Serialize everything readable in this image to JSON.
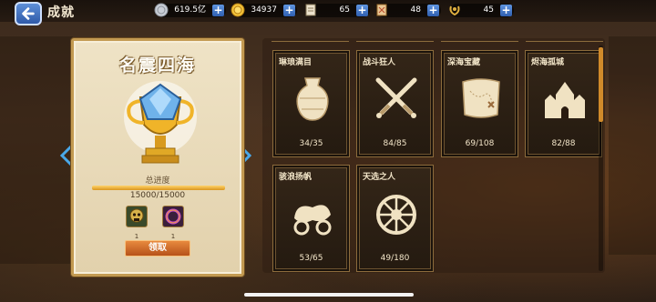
{
  "header": {
    "title": "成就",
    "back_icon": "back-arrow-icon"
  },
  "resources": [
    {
      "name": "silver",
      "icon": "silver-coin-icon",
      "value": "619.5亿"
    },
    {
      "name": "gold",
      "icon": "gold-coin-icon",
      "value": "34937"
    },
    {
      "name": "scroll",
      "icon": "scroll-icon",
      "value": "65"
    },
    {
      "name": "map",
      "icon": "map-icon",
      "value": "48"
    },
    {
      "name": "laurel",
      "icon": "laurel-icon",
      "value": "45"
    }
  ],
  "detail": {
    "title": "名震四海",
    "progress_label": "总进度",
    "progress_text": "15000/15000",
    "progress_fraction": 1.0,
    "rewards": [
      {
        "icon": "skull-badge-icon",
        "count": "1"
      },
      {
        "icon": "purple-ring-icon",
        "count": "1"
      }
    ],
    "claim_label": "领取"
  },
  "achievements": [
    {
      "title": "琳琅满目",
      "icon": "vase-icon",
      "count": "34/35"
    },
    {
      "title": "战斗狂人",
      "icon": "crossed-swords-icon",
      "count": "84/85"
    },
    {
      "title": "深海宝藏",
      "icon": "treasure-map-icon",
      "count": "69/108"
    },
    {
      "title": "烬海孤城",
      "icon": "castle-icon",
      "count": "82/88"
    },
    {
      "title": "骇浪扬帆",
      "icon": "cannon-icon",
      "count": "53/65"
    },
    {
      "title": "天选之人",
      "icon": "ship-wheel-icon",
      "count": "49/180"
    }
  ],
  "colors": {
    "accent_gold": "#d9961e",
    "claim_button": "#d06a28",
    "plus_button": "#3f75c8"
  }
}
